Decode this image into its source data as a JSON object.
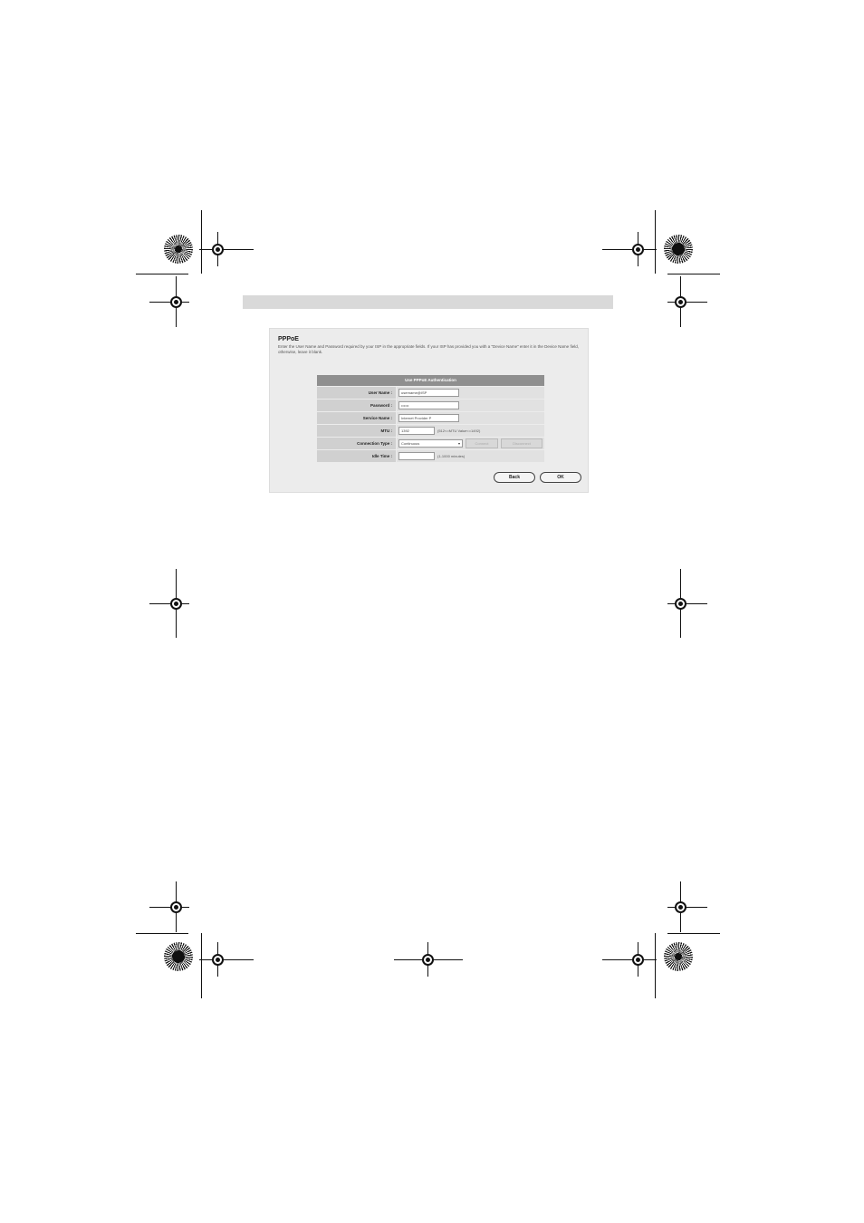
{
  "page": {
    "heading": "PPPoE",
    "description": "Enter the User Name and Password required by your ISP in the appropriate fields. If your ISP has provided you with a \"Device Name\" enter it in the Device Name field, otherwise, leave it blank.",
    "table_title": "Use PPPoE Authentication",
    "rows": [
      {
        "label": "User Name :",
        "value": "username@ISP"
      },
      {
        "label": "Password :",
        "value": "••••••"
      },
      {
        "label": "Service Name :",
        "value": "Internet Provider P"
      },
      {
        "label": "MTU :",
        "value": "1392",
        "hint": "(512<=MTU Value<=1492)"
      },
      {
        "label": "Connection Type :",
        "value": "Continuous",
        "connect": "Connect",
        "disconnect": "Disconnect"
      },
      {
        "label": "Idle Time :",
        "value": "",
        "hint": "(1-1000 minutes)"
      }
    ],
    "back_label": "Back",
    "ok_label": "OK"
  },
  "icons": {
    "registration_mark": "crosshair-target-icon",
    "color_wheel": "starburst-wheel-icon"
  }
}
